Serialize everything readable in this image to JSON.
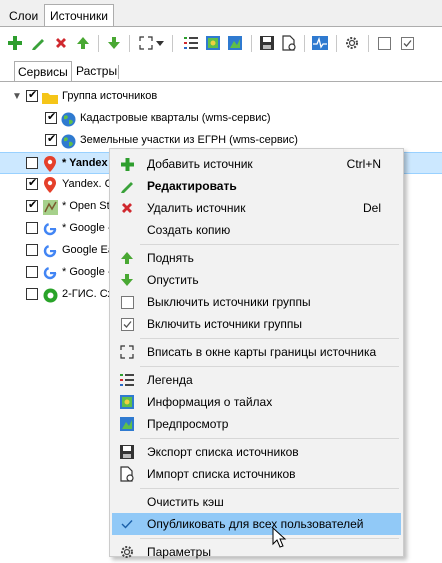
{
  "top_tabs": [
    "Слои",
    "Источники"
  ],
  "sub_tabs": [
    "Сервисы",
    "Растры"
  ],
  "toolbar": {
    "icons": [
      "add-icon",
      "edit-icon",
      "delete-icon",
      "move-up-icon",
      "move-down-icon",
      "fit-extent-icon",
      "dropdown-arrow-icon",
      "legend-icon",
      "tile-info-icon",
      "preview-icon",
      "export-icon",
      "import-icon",
      "pulse-icon",
      "settings-icon",
      "unchecked-box-icon",
      "checked-box-icon"
    ]
  },
  "tree": {
    "rows": [
      {
        "label": "Группа источников",
        "checked": true,
        "icon": "folder-icon"
      },
      {
        "label": "Кадастровые кварталы (wms-сервис)",
        "checked": true,
        "icon": "globe-icon"
      },
      {
        "label": "Земельные участки из ЕГРН (wms-сервис)",
        "checked": true,
        "icon": "globe-icon"
      },
      {
        "label": "* Yandex",
        "checked": false,
        "icon": "map-pin-icon"
      },
      {
        "label": "Yandex. С",
        "checked": true,
        "icon": "map-pin-icon"
      },
      {
        "label": "* Open St",
        "checked": true,
        "icon": "osm-icon"
      },
      {
        "label": "* Google -",
        "checked": false,
        "icon": "google-icon"
      },
      {
        "label": "Google Ea",
        "checked": false,
        "icon": "google-icon"
      },
      {
        "label": "* Google -",
        "checked": false,
        "icon": "google-icon"
      },
      {
        "label": "2-ГИС. Сх",
        "checked": false,
        "icon": "2gis-icon"
      }
    ]
  },
  "context_menu": {
    "items": [
      {
        "label": "Добавить источник",
        "shortcut": "Ctrl+N"
      },
      {
        "label": "Редактировать",
        "shortcut": ""
      },
      {
        "label": "Удалить источник",
        "shortcut": "Del"
      },
      {
        "label": "Создать копию",
        "shortcut": ""
      },
      {
        "label": "Поднять",
        "shortcut": ""
      },
      {
        "label": "Опустить",
        "shortcut": ""
      },
      {
        "label": "Выключить источники группы",
        "shortcut": ""
      },
      {
        "label": "Включить источники группы",
        "shortcut": ""
      },
      {
        "label": "Вписать в окне карты границы источника",
        "shortcut": ""
      },
      {
        "label": "Легенда",
        "shortcut": ""
      },
      {
        "label": "Информация о тайлах",
        "shortcut": ""
      },
      {
        "label": "Предпросмотр",
        "shortcut": ""
      },
      {
        "label": "Экспорт списка источников",
        "shortcut": ""
      },
      {
        "label": "Импорт списка источников",
        "shortcut": ""
      },
      {
        "label": "Очистить кэш",
        "shortcut": ""
      },
      {
        "label": "Опубликовать для всех пользователей",
        "shortcut": ""
      },
      {
        "label": "Параметры",
        "shortcut": ""
      }
    ]
  },
  "colors": {
    "accent": "#91c9f7",
    "selected_row": "#cce8ff",
    "green": "#2e9e2e",
    "red": "#d0282e"
  }
}
